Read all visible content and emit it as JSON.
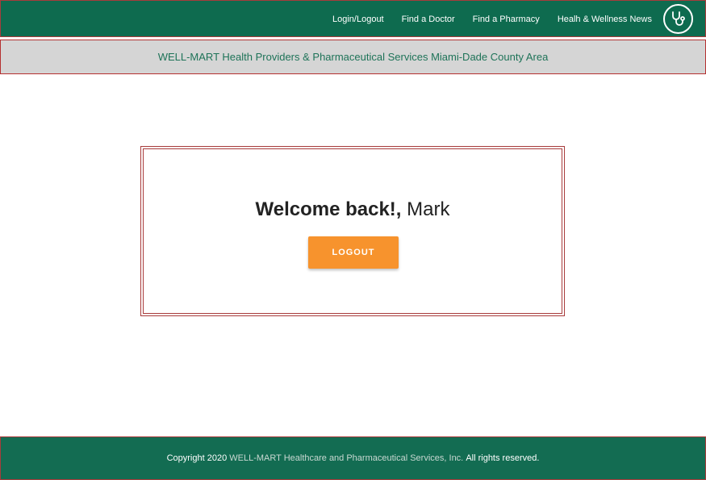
{
  "nav": {
    "links": [
      "Login/Logout",
      "Find a Doctor",
      "Find a Pharmacy",
      "Healh & Wellness News"
    ],
    "logo_icon": "stethoscope-icon"
  },
  "banner": {
    "text": "WELL-MART Health Providers & Pharmaceutical Services Miami-Dade County Area"
  },
  "welcome": {
    "greeting": "Welcome back!,",
    "name": "Mark",
    "logout_label": "LOGOUT"
  },
  "footer": {
    "prefix": "Copyright 2020",
    "company": "WELL-MART Healthcare and Pharmaceutical Services, Inc.",
    "suffix": "All rights reserved."
  },
  "colors": {
    "header_bg": "#0e6b4f",
    "banner_bg": "#d5d5d5",
    "banner_text": "#1e7358",
    "accent_orange": "#f7932d",
    "border_red": "#a83b3b"
  }
}
